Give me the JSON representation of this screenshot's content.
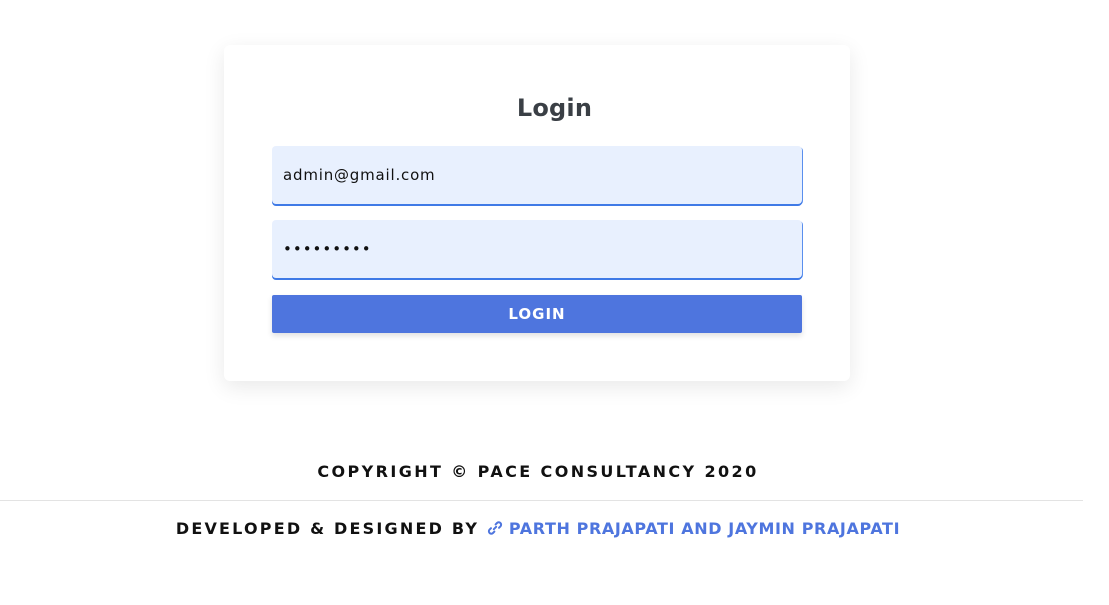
{
  "login_card": {
    "title": "Login",
    "email_value": "admin@gmail.com",
    "password_value": "•••••••••",
    "login_button_label": "LOGIN"
  },
  "footer": {
    "copyright": "COPYRIGHT © PACE CONSULTANCY 2020",
    "developed_by_label": "DEVELOPED & DESIGNED BY",
    "developers_link_text": "PARTH PRAJAPATI AND JAYMIN PRAJAPATI",
    "link_icon": "link-icon"
  },
  "colors": {
    "accent": "#4e75de",
    "input_background": "#e8f0fe",
    "input_border": "#3f7ae6"
  }
}
